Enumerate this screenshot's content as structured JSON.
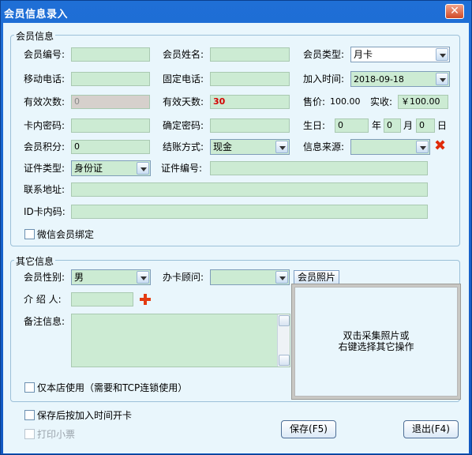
{
  "window": {
    "title": "会员信息录入",
    "close_glyph": "✕"
  },
  "member_info": {
    "group_title": "会员信息",
    "member_no_label": "会员编号:",
    "member_no": "",
    "member_name_label": "会员姓名:",
    "member_name": "",
    "member_type_label": "会员类型:",
    "member_type": "月卡",
    "mobile_label": "移动电话:",
    "mobile": "",
    "phone_label": "固定电话:",
    "phone": "",
    "join_time_label": "加入时间:",
    "join_time": "2018-09-18",
    "valid_count_label": "有效次数:",
    "valid_count": "0",
    "valid_days_label": "有效天数:",
    "valid_days": "30",
    "price_label": "售价:",
    "price": "100.00",
    "paid_label": "实收:",
    "paid": "￥100.00",
    "card_pwd_label": "卡内密码:",
    "card_pwd": "",
    "confirm_pwd_label": "确定密码:",
    "confirm_pwd": "",
    "birthday_label": "生日:",
    "birth_year": "0",
    "year_unit": "年",
    "birth_month": "0",
    "month_unit": "月",
    "birth_day": "0",
    "day_unit": "日",
    "points_label": "会员积分:",
    "points": "0",
    "payment_label": "结账方式:",
    "payment": "现金",
    "source_label": "信息来源:",
    "source": "",
    "id_type_label": "证件类型:",
    "id_type": "身份证",
    "id_no_label": "证件编号:",
    "id_no": "",
    "address_label": "联系地址:",
    "address": "",
    "idcard_code_label": "ID卡内码:",
    "idcard_code": "",
    "wechat_bind_label": "微信会员绑定"
  },
  "other_info": {
    "group_title": "其它信息",
    "gender_label": "会员性别:",
    "gender": "男",
    "advisor_label": "办卡顾问:",
    "advisor": "",
    "referrer_label": "介 绍 人:",
    "referrer": "",
    "remark_label": "备注信息:",
    "remark": "",
    "store_only_label": "仅本店使用（需要和TCP连锁使用）",
    "photo_tab": "会员照片",
    "photo_hint_line1": "双击采集照片或",
    "photo_hint_line2": "右键选择其它操作"
  },
  "footer": {
    "open_card_label": "保存后按加入时间开卡",
    "print_ticket_label": "打印小票",
    "save_button": "保存(F5)",
    "exit_button": "退出(F4)"
  },
  "colors": {
    "input_green": "#ccebd3",
    "client_bg": "#e9f6fc",
    "title_blue": "#1f6fd6",
    "accent_red": "#e02b0a"
  }
}
